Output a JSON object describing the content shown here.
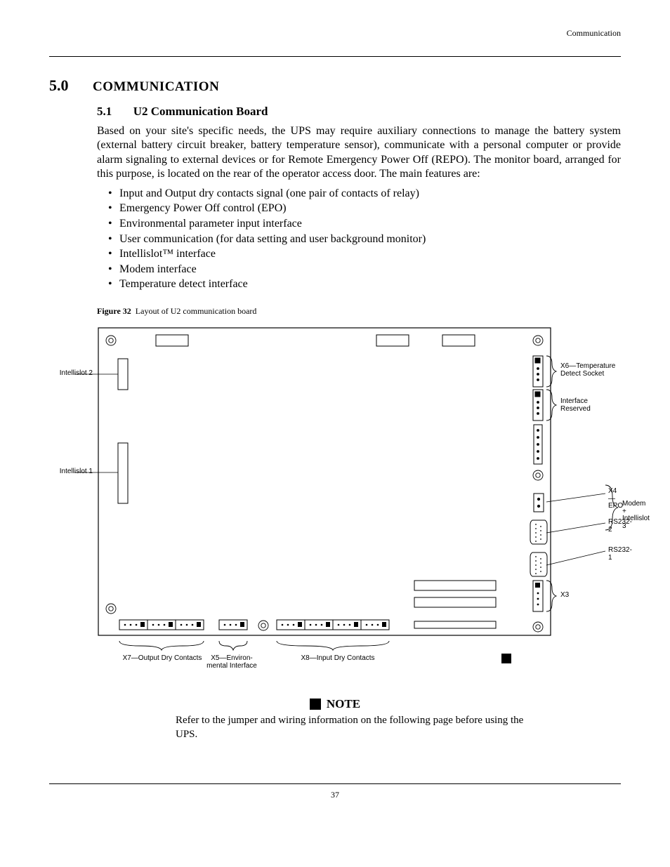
{
  "header": {
    "right": "Communication"
  },
  "section": {
    "num": "5.0",
    "title": "COMMUNICATION"
  },
  "sub": {
    "num": "5.1",
    "title": "U2 Communication Board"
  },
  "intro": "Based on your site's specific needs, the UPS may require auxiliary connections to manage the battery system (external battery circuit breaker, battery temperature sensor), communicate with a personal computer or provide alarm signaling to external devices or for Remote Emergency Power Off (REPO). The monitor board, arranged for this purpose, is located on the rear of the operator access door. The main features are:",
  "bullets": [
    "Input and Output dry contacts signal (one pair of contacts of relay)",
    "Emergency Power Off control (EPO)",
    "Environmental parameter input interface",
    "User communication (for data setting and user background monitor)",
    "Intellislot™ interface",
    "Modem interface",
    "Temperature detect interface"
  ],
  "figure": {
    "label": "Figure 32",
    "title": "Layout of U2 communication board"
  },
  "labels": {
    "tempDetect": "X6—Temperature\nDetect Socket",
    "interfaceReserved": "Interface\nReserved",
    "x3": "X3",
    "modem": "Modem +\nIntellislot 3",
    "intellislot2": "Intellislot 2",
    "intellislot1": "Intellislot 1",
    "rs232_2": "RS232-2",
    "rs232_1": "RS232-1",
    "epo": "X4—EPO",
    "outputDry": "X7—Output Dry Contacts",
    "inputDry": "X8—Input Dry Contacts",
    "x5Env": "X5—Environ-\nmental Interface"
  },
  "note": {
    "head": "NOTE",
    "body": "Refer to the jumper and wiring information on the following page before using the UPS."
  },
  "footer": {
    "page": "37"
  }
}
